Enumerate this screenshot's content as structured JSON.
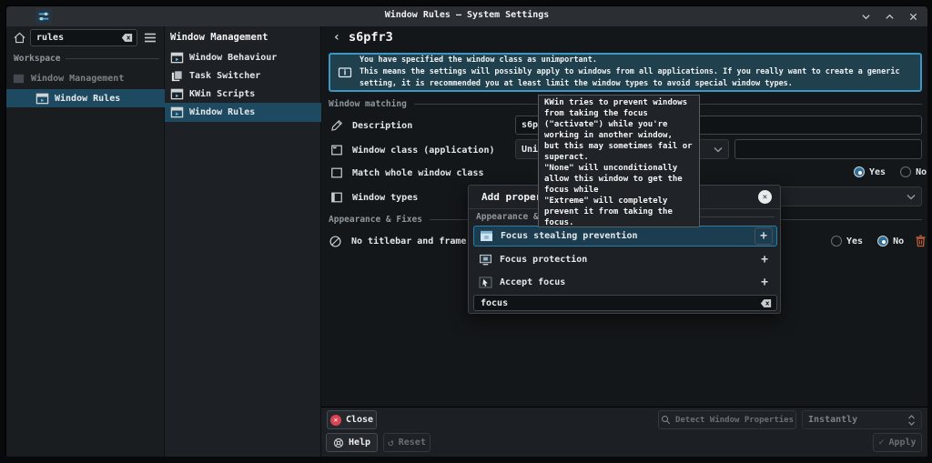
{
  "window": {
    "title": "Window Rules — System Settings"
  },
  "sidebar": {
    "search": {
      "value": "rules"
    },
    "section": "Workspace",
    "items": [
      {
        "label": "Window Management"
      },
      {
        "label": "Window Rules"
      }
    ]
  },
  "nav": {
    "header": "Window Management",
    "items": [
      {
        "label": "Window Behaviour"
      },
      {
        "label": "Task Switcher"
      },
      {
        "label": "KWin Scripts"
      },
      {
        "label": "Window Rules"
      }
    ]
  },
  "main": {
    "title": "s6pfr3",
    "notice": "You have specified the window class as unimportant.\nThis means the settings will possibly apply to windows from all applications. If you really want to create a generic\nsetting, it is recommended you at least limit the window types to avoid special window types.",
    "matching": {
      "heading": "Window matching",
      "description_label": "Description",
      "description_value": "s6pfr3",
      "window_class_label": "Window class (application)",
      "window_class_value": "Unimportant",
      "window_class_text": "",
      "match_whole_label": "Match whole window class",
      "window_types_label": "Window types"
    },
    "appearance": {
      "heading": "Appearance & Fixes",
      "no_titlebar_label": "No titlebar and frame"
    },
    "radio_yes": "Yes",
    "radio_no": "No"
  },
  "popup": {
    "title": "Add property",
    "section": "Appearance & Fixes",
    "items": [
      {
        "label": "Focus stealing prevention"
      },
      {
        "label": "Focus protection"
      },
      {
        "label": "Accept focus"
      }
    ],
    "add_symbol": "+",
    "search_value": "focus"
  },
  "tooltip": {
    "text": "KWin tries to prevent windows\nfrom taking the focus\n(\"activate\") while you're\nworking in another window,\nbut this may sometimes fail or\nsuperact.\n\"None\" will unconditionally\nallow this window to get the\nfocus while\n\"Extreme\" will completely\nprevent it from taking the\nfocus."
  },
  "footer": {
    "close": "Close",
    "help": "Help",
    "reset": "Reset",
    "detect": "Detect Window Properties",
    "mode": "Instantly",
    "apply": "Apply"
  },
  "colors": {
    "accent": "#3c97c4",
    "selection": "#1d4a60",
    "danger": "#da4453",
    "trash": "#c65f38"
  }
}
